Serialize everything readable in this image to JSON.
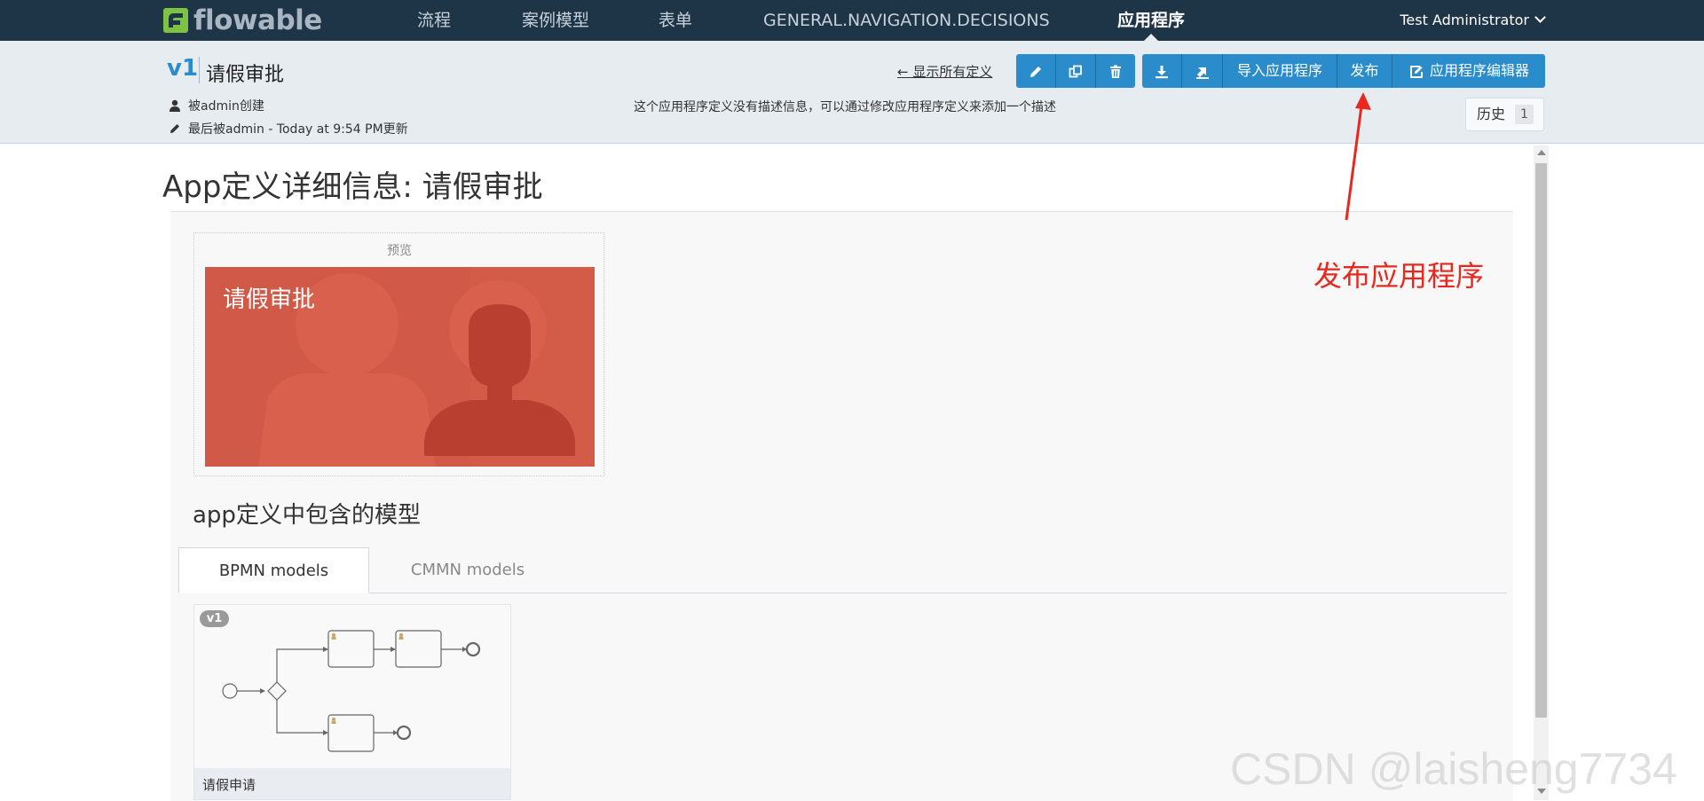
{
  "nav": {
    "logo_text": "flowable",
    "items": [
      "流程",
      "案例模型",
      "表单",
      "GENERAL.NAVIGATION.DECISIONS",
      "应用程序"
    ],
    "active_index": 4,
    "user": "Test Administrator",
    "colors": {
      "bar": "#1e3447",
      "logo_green": "#7dc242"
    }
  },
  "app": {
    "version": "v1",
    "name": "请假审批",
    "created_by": "被admin创建",
    "updated": "最后被admin - Today at 9:54 PM更新",
    "show_all_link": "← 显示所有定义",
    "description": "这个应用程序定义没有描述信息，可以通过修改应用程序定义来添加一个描述"
  },
  "toolbar": {
    "edit_icon": "pencil-icon",
    "copy_icon": "copy-icon",
    "delete_icon": "trash-icon",
    "export_icon": "download-icon",
    "export_zip_icon": "export-icon",
    "import_label": "导入应用程序",
    "publish_label": "发布",
    "editor_label": "应用程序编辑器",
    "accent": "#2b8ccb"
  },
  "history": {
    "label": "历史",
    "count": "1"
  },
  "main": {
    "page_title": "App定义详细信息: 请假审批",
    "preview_label": "预览",
    "tile_title": "请假审批",
    "tile_color": "#d05a47",
    "models_heading": "app定义中包含的模型",
    "tabs": [
      "BPMN models",
      "CMMN models"
    ],
    "active_tab": 0,
    "models": [
      {
        "badge": "v1",
        "name": "请假申请"
      }
    ]
  },
  "annotation": {
    "text": "发布应用程序",
    "color": "#e8281f"
  },
  "watermark": "CSDN @laisheng7734"
}
